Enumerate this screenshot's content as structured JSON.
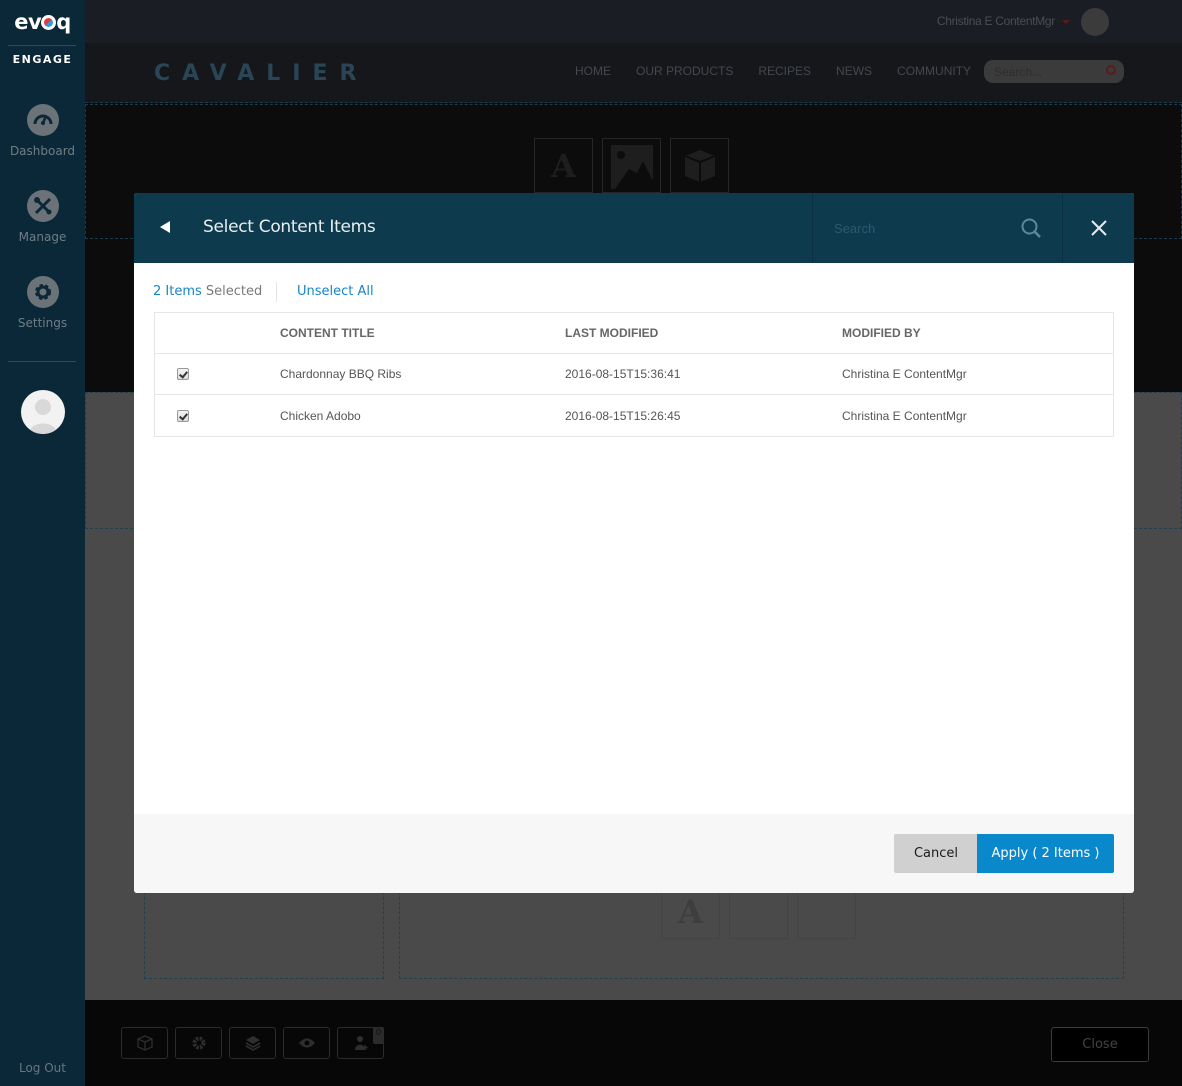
{
  "sidebar": {
    "logo_text": "evoq",
    "product": "ENGAGE",
    "items": [
      {
        "label": "Dashboard",
        "icon": "dashboard-gauge-icon"
      },
      {
        "label": "Manage",
        "icon": "wrench-screwdriver-icon"
      },
      {
        "label": "Settings",
        "icon": "gear-icon"
      }
    ],
    "logout_label": "Log Out"
  },
  "site": {
    "user_name": "Christina E ContentMgr",
    "brand": "CAVALIER",
    "nav": [
      "HOME",
      "OUR PRODUCTS",
      "RECIPES",
      "NEWS",
      "COMMUNITY"
    ],
    "search_placeholder": "Search...",
    "bottom_badge_count": "0",
    "close_label": "Close"
  },
  "modal": {
    "title": "Select Content Items",
    "search_placeholder": "Search",
    "selected_count": "2 Items",
    "selected_word": "Selected",
    "unselect_all": "Unselect All",
    "columns": [
      "CONTENT TITLE",
      "LAST MODIFIED",
      "MODIFIED BY"
    ],
    "rows": [
      {
        "checked": true,
        "title": "Chardonnay BBQ Ribs",
        "modified": "2016-08-15T15:36:41",
        "by": "Christina E ContentMgr"
      },
      {
        "checked": true,
        "title": "Chicken Adobo",
        "modified": "2016-08-15T15:26:45",
        "by": "Christina E ContentMgr"
      }
    ],
    "cancel_label": "Cancel",
    "apply_label": "Apply ( 2 Items )"
  },
  "colors": {
    "sidebar_bg": "#0b2838",
    "modal_header_bg": "#0e3a4e",
    "accent_blue": "#0a88cc",
    "link_blue": "#1786c6"
  }
}
